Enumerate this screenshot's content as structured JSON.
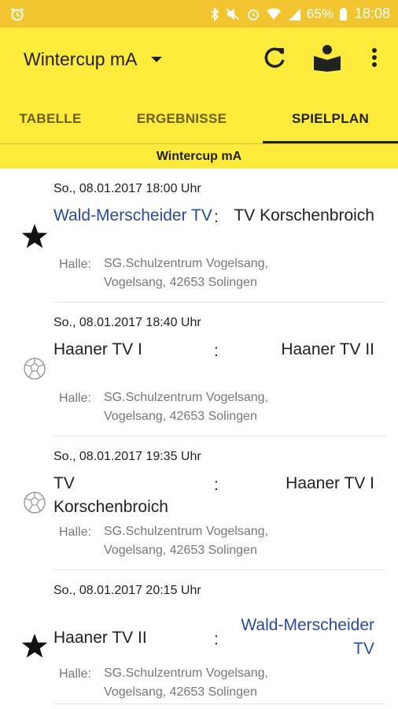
{
  "status_bar": {
    "battery_percent": "65%",
    "time": "18:08",
    "icons": [
      "alarm-icon",
      "bluetooth-icon",
      "mute-icon",
      "alarm-clock-icon",
      "wifi-icon",
      "signal-icon",
      "battery-icon"
    ],
    "color": "#f2c530"
  },
  "app_bar": {
    "title": "Wintercup mA",
    "actions": [
      "refresh-icon",
      "book-reader-icon",
      "more-vert-icon"
    ],
    "color": "#ffeb3b"
  },
  "tabs": [
    {
      "label": "TABELLE",
      "active": false
    },
    {
      "label": "ERGEBNISSE",
      "active": false
    },
    {
      "label": "SPIELPLAN",
      "active": true
    }
  ],
  "section": {
    "title": "Wintercup mA"
  },
  "colors": {
    "link": "#2a4a9c",
    "accent": "#ffeb3b",
    "muted_text": "#777777"
  },
  "matches": [
    {
      "date": "So., 08.01.2017 18:00 Uhr",
      "home": "Wald-Merscheider TV",
      "away": "TV Korschenbroich",
      "separator": ":",
      "venue_label": "Halle:",
      "venue_line1": "SG.Schulzentrum Vogelsang,",
      "venue_line2": "Vogelsang, 42653 Solingen",
      "icon": "star-icon",
      "highlighted_team": "home"
    },
    {
      "date": "So., 08.01.2017 18:40 Uhr",
      "home": "Haaner TV I",
      "away": "Haaner TV II",
      "separator": ":",
      "venue_label": "Halle:",
      "venue_line1": "SG.Schulzentrum Vogelsang,",
      "venue_line2": "Vogelsang, 42653 Solingen",
      "icon": "handball-icon",
      "highlighted_team": "none"
    },
    {
      "date": "So., 08.01.2017 19:35 Uhr",
      "home": "TV Korschenbroich",
      "away": "Haaner TV I",
      "separator": ":",
      "venue_label": "Halle:",
      "venue_line1": "SG.Schulzentrum Vogelsang,",
      "venue_line2": "Vogelsang, 42653 Solingen",
      "icon": "handball-icon",
      "highlighted_team": "none"
    },
    {
      "date": "So., 08.01.2017 20:15 Uhr",
      "home": "Haaner TV II",
      "away": "Wald-Merscheider TV",
      "separator": ":",
      "venue_label": "Halle:",
      "venue_line1": "SG.Schulzentrum Vogelsang,",
      "venue_line2": "Vogelsang, 42653 Solingen",
      "icon": "star-icon",
      "highlighted_team": "away"
    }
  ]
}
